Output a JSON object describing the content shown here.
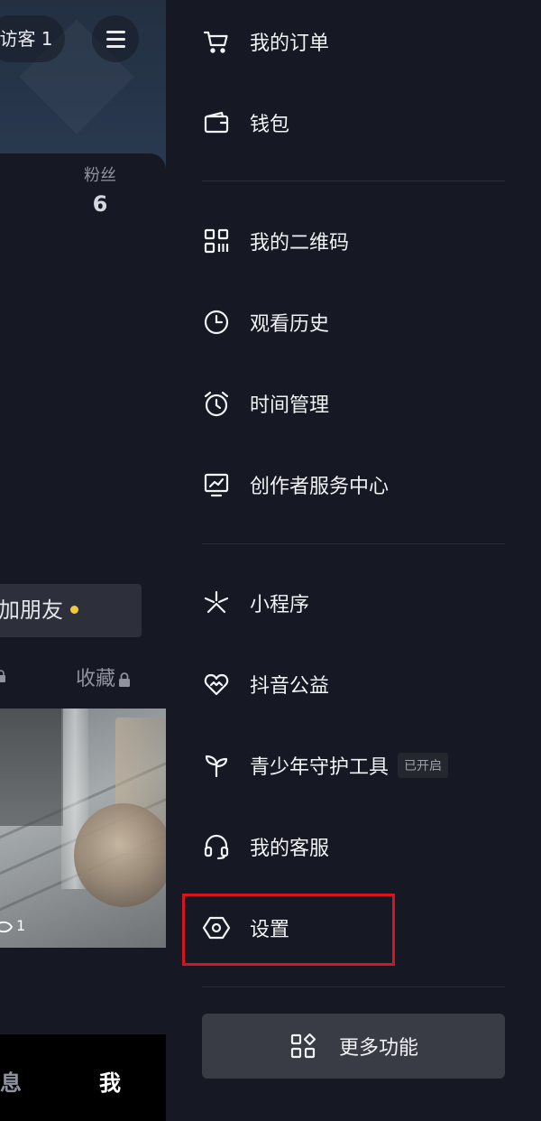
{
  "profile": {
    "visitors_label": "访客 1",
    "fans_label": "粉丝",
    "fans_count": "6",
    "add_friend_label": "加朋友",
    "favorites_tab": "收藏",
    "video_likes": "1",
    "nav_messages": "消息",
    "nav_me": "我"
  },
  "menu": {
    "group1": [
      {
        "label": "我的订单",
        "icon": "cart-icon"
      },
      {
        "label": "钱包",
        "icon": "wallet-icon"
      }
    ],
    "group2": [
      {
        "label": "我的二维码",
        "icon": "qrcode-icon"
      },
      {
        "label": "观看历史",
        "icon": "clock-icon"
      },
      {
        "label": "时间管理",
        "icon": "alarm-icon"
      },
      {
        "label": "创作者服务中心",
        "icon": "monitor-chart-icon"
      }
    ],
    "group3": [
      {
        "label": "小程序",
        "icon": "mini-program-icon"
      },
      {
        "label": "抖音公益",
        "icon": "charity-heart-icon"
      },
      {
        "label": "青少年守护工具",
        "icon": "sprout-icon",
        "badge": "已开启"
      },
      {
        "label": "我的客服",
        "icon": "headset-icon"
      },
      {
        "label": "设置",
        "icon": "settings-hexagon-icon"
      }
    ],
    "more_label": "更多功能"
  },
  "colors": {
    "background": "#161823",
    "highlight": "#d3161d",
    "more_button": "#393b45"
  }
}
